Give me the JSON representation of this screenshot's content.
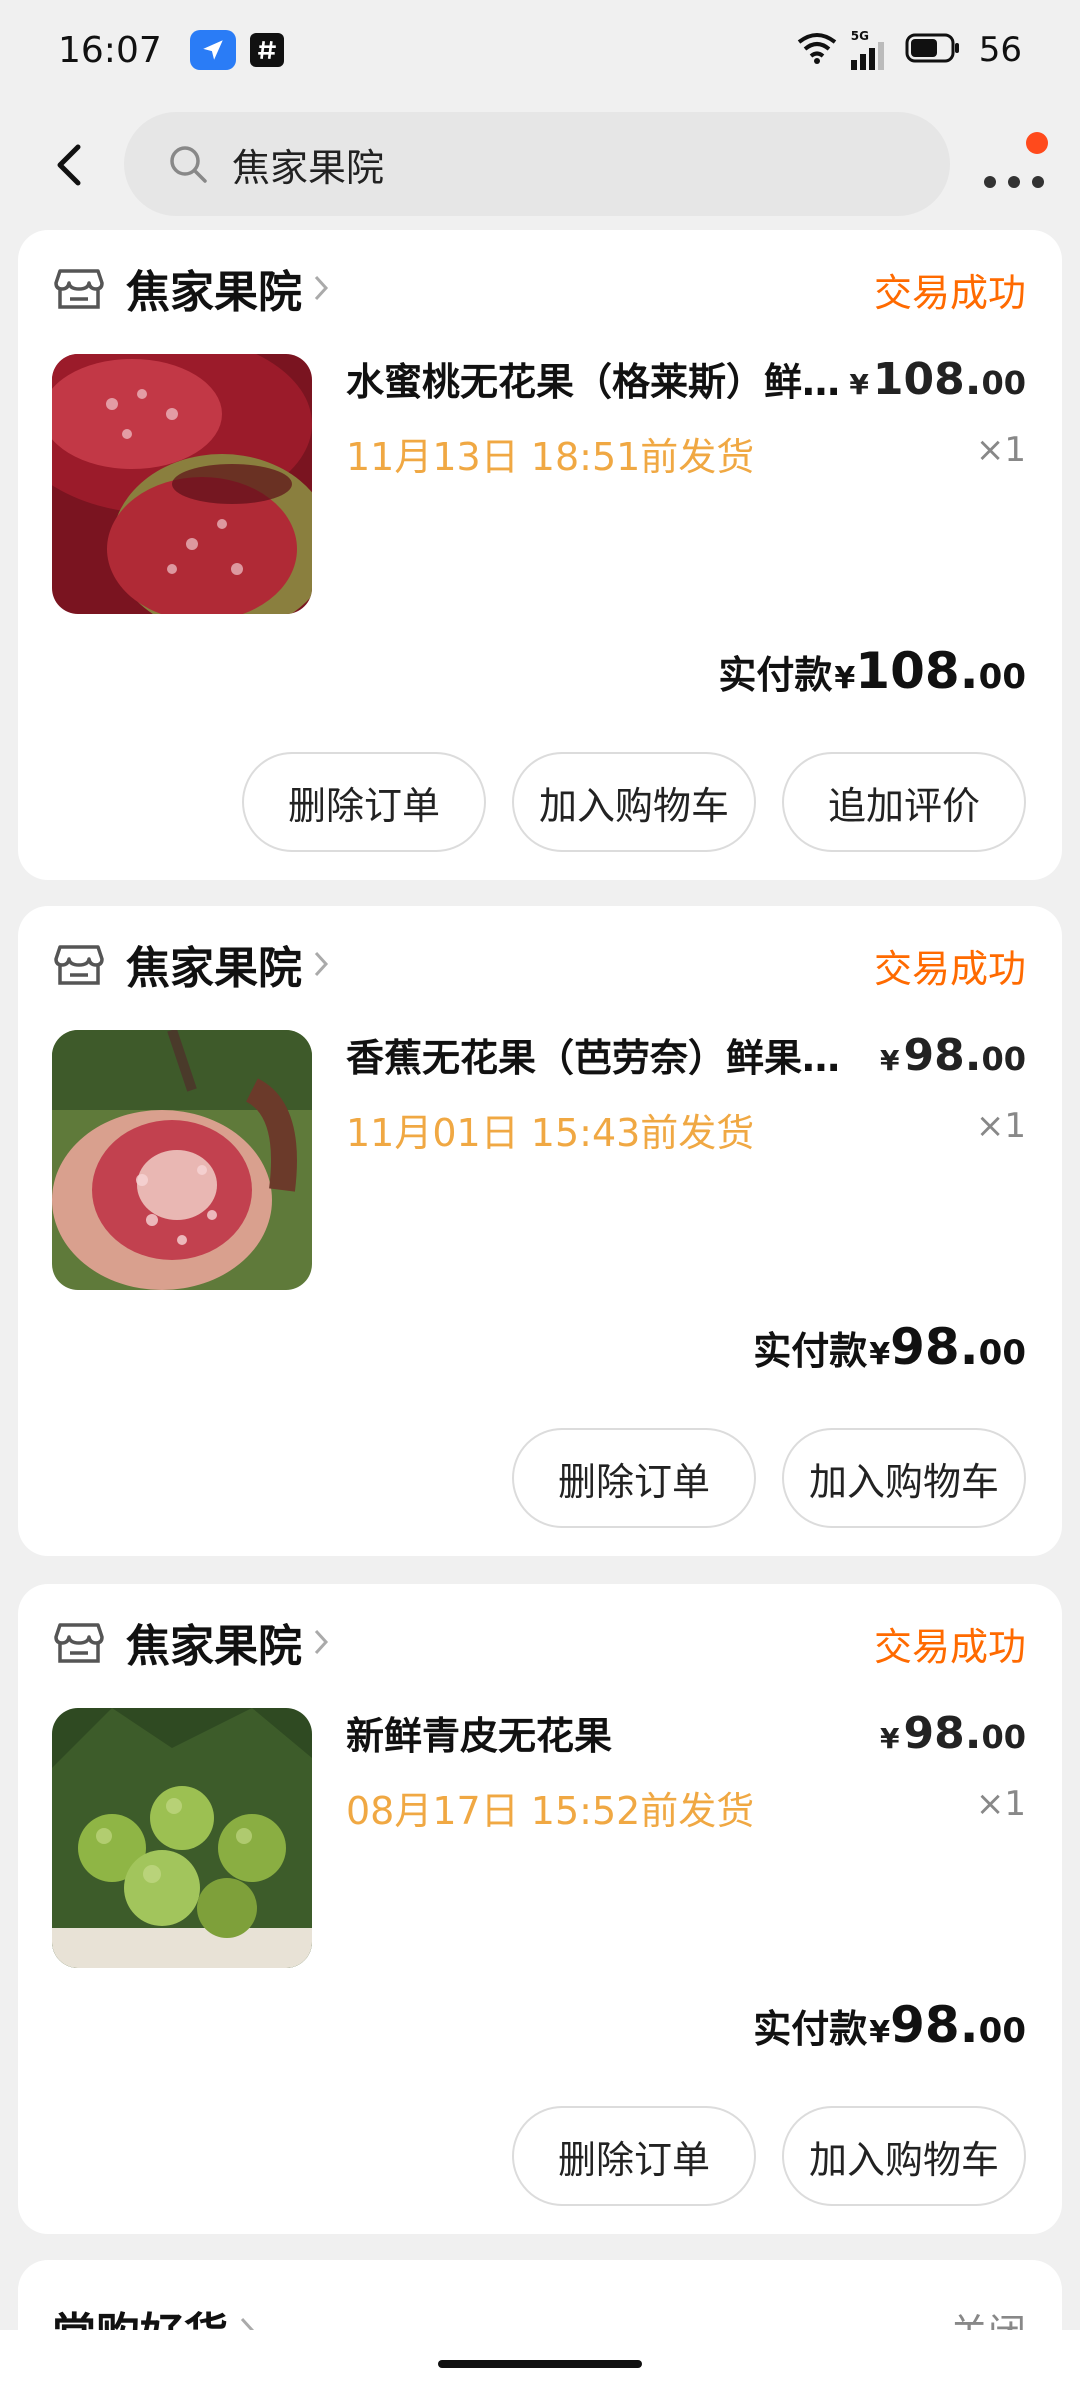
{
  "status_bar": {
    "time": "16:07",
    "network_label": "5G",
    "battery_level": "56",
    "icons": [
      "location-arrow-icon",
      "hash-icon",
      "wifi-icon",
      "signal-icon",
      "battery-icon"
    ]
  },
  "nav": {
    "back_icon": "chevron-left-icon",
    "search_icon": "search-icon",
    "search_value": "焦家果院",
    "more_icon": "more-dots-icon",
    "notification_dot_color": "#ff4a1c"
  },
  "orders": [
    {
      "store": "焦家果院",
      "status": "交易成功",
      "title": "水蜜桃无花果（格莱斯）鲜果现摘",
      "ship_time": "11月13日 18:51前发货",
      "price_currency": "¥",
      "price_int": "108.",
      "price_dec": "00",
      "qty": "×1",
      "paid_label": "实付款",
      "paid_currency": "¥",
      "paid_int": "108.",
      "paid_dec": "00",
      "buttons": [
        "删除订单",
        "加入购物车",
        "追加评价"
      ]
    },
    {
      "store": "焦家果院",
      "status": "交易成功",
      "title": "香蕉无花果（芭劳奈）鲜果现摘",
      "ship_time": "11月01日 15:43前发货",
      "price_currency": "¥",
      "price_int": "98.",
      "price_dec": "00",
      "qty": "×1",
      "paid_label": "实付款",
      "paid_currency": "¥",
      "paid_int": "98.",
      "paid_dec": "00",
      "buttons": [
        "删除订单",
        "加入购物车"
      ]
    },
    {
      "store": "焦家果院",
      "status": "交易成功",
      "title": "新鲜青皮无花果",
      "ship_time": "08月17日 15:52前发货",
      "price_currency": "¥",
      "price_int": "98.",
      "price_dec": "00",
      "qty": "×1",
      "paid_label": "实付款",
      "paid_currency": "¥",
      "paid_int": "98.",
      "paid_dec": "00",
      "buttons": [
        "删除订单",
        "加入购物车"
      ]
    }
  ],
  "recommend": {
    "title": "常购好货",
    "close": "关闭"
  },
  "colors": {
    "accent_orange": "#ff6a00",
    "ship_time_orange": "#f0a843",
    "background": "#f0f0f0"
  }
}
